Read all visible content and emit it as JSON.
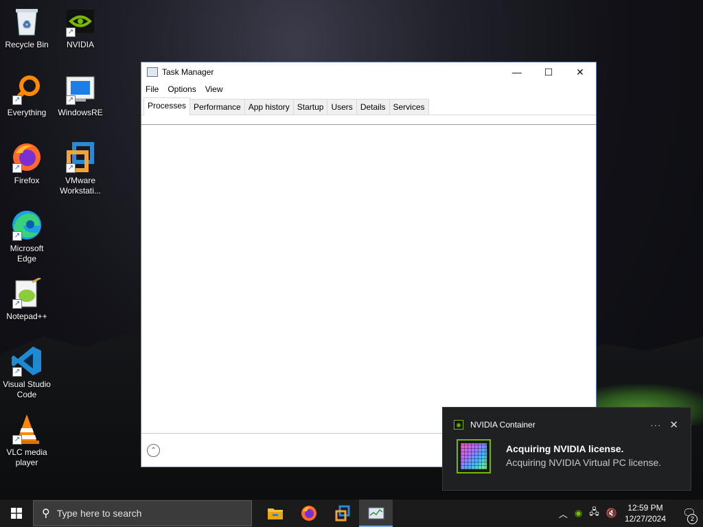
{
  "desktop": {
    "icons": [
      {
        "label": "Recycle Bin",
        "icon": "recycle-bin-icon"
      },
      {
        "label": "NVIDIA",
        "icon": "nvidia-icon"
      },
      {
        "label": "Everything",
        "icon": "everything-search-icon"
      },
      {
        "label": "WindowsRE",
        "icon": "windowsre-icon"
      },
      {
        "label": "Firefox",
        "icon": "firefox-icon"
      },
      {
        "label": "VMware Workstati...",
        "icon": "vmware-icon"
      },
      {
        "label": "Microsoft Edge",
        "icon": "edge-icon"
      },
      {
        "label": "Notepad++",
        "icon": "notepadpp-icon"
      },
      {
        "label": "Visual Studio Code",
        "icon": "vscode-icon"
      },
      {
        "label": "VLC media player",
        "icon": "vlc-icon"
      }
    ]
  },
  "task_manager": {
    "title": "Task Manager",
    "menu": [
      "File",
      "Options",
      "View"
    ],
    "tabs": [
      "Processes",
      "Performance",
      "App history",
      "Startup",
      "Users",
      "Details",
      "Services"
    ],
    "active_tab": "Processes",
    "controls": {
      "minimize": "—",
      "maximize": "☐",
      "close": "✕"
    }
  },
  "notification": {
    "app": "NVIDIA Container",
    "title": "Acquiring NVIDIA license.",
    "body": "Acquiring NVIDIA Virtual PC license.",
    "more": "···",
    "close": "✕"
  },
  "taskbar": {
    "search_placeholder": "Type here to search",
    "time": "12:59 PM",
    "date": "12/27/2024",
    "notification_count": "2",
    "colors": {
      "background": "#1b1b1b",
      "accent": "#7aa7e0"
    }
  }
}
